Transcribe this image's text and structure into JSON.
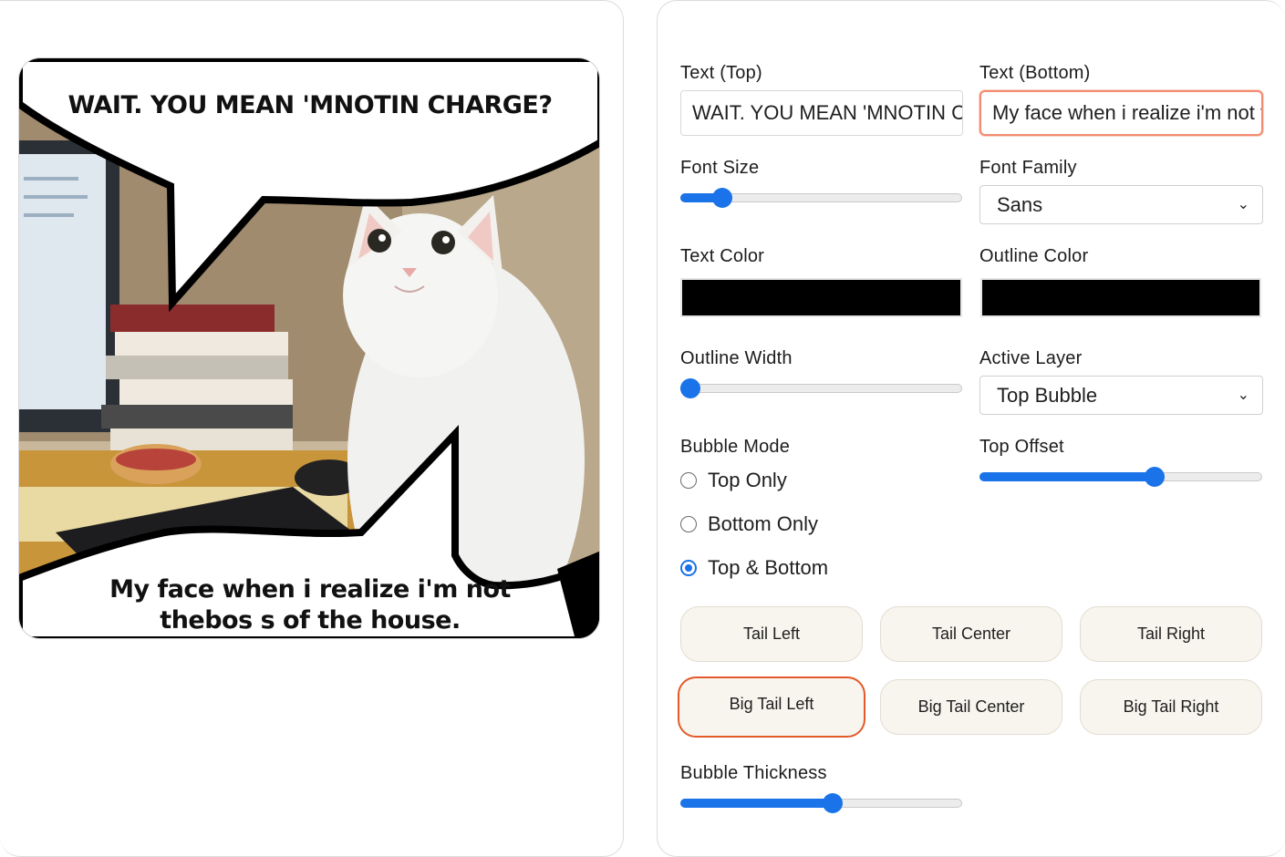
{
  "meme": {
    "top_text": "WAIT. YOU MEAN 'MNOTIN CHARGE?",
    "bottom_text": "My face when i realize i'm not thebos s of the house."
  },
  "controls": {
    "text_top": {
      "label": "Text (Top)",
      "value": "WAIT. YOU MEAN 'MNOTIN CHARGE?"
    },
    "text_bottom": {
      "label": "Text (Bottom)",
      "value": "My face when i realize i'm not thebos s of the house."
    },
    "font_size": {
      "label": "Font Size",
      "value_fraction": 0.15
    },
    "font_family": {
      "label": "Font Family",
      "selected": "Sans"
    },
    "text_color": {
      "label": "Text Color",
      "value": "#000000"
    },
    "outline_color": {
      "label": "Outline Color",
      "value": "#000000"
    },
    "outline_width": {
      "label": "Outline Width",
      "value_fraction": 0.0
    },
    "active_layer": {
      "label": "Active Layer",
      "selected": "Top Bubble"
    },
    "bubble_mode": {
      "label": "Bubble Mode",
      "options": [
        "Top Only",
        "Bottom Only",
        "Top & Bottom"
      ],
      "selected": "Top & Bottom"
    },
    "top_offset": {
      "label": "Top Offset",
      "value_fraction": 0.62
    },
    "tail_buttons": [
      "Tail Left",
      "Tail Center",
      "Tail Right",
      "Big Tail Left",
      "Big Tail Center",
      "Big Tail Right"
    ],
    "selected_tail": "Big Tail Left",
    "bubble_thickness": {
      "label": "Bubble Thickness",
      "value_fraction": 0.54
    }
  },
  "colors": {
    "accent": "#1a73e8",
    "selected_outline": "#e3592a",
    "focus_outline": "#f28b70",
    "pill_bg": "#f8f5ee"
  }
}
